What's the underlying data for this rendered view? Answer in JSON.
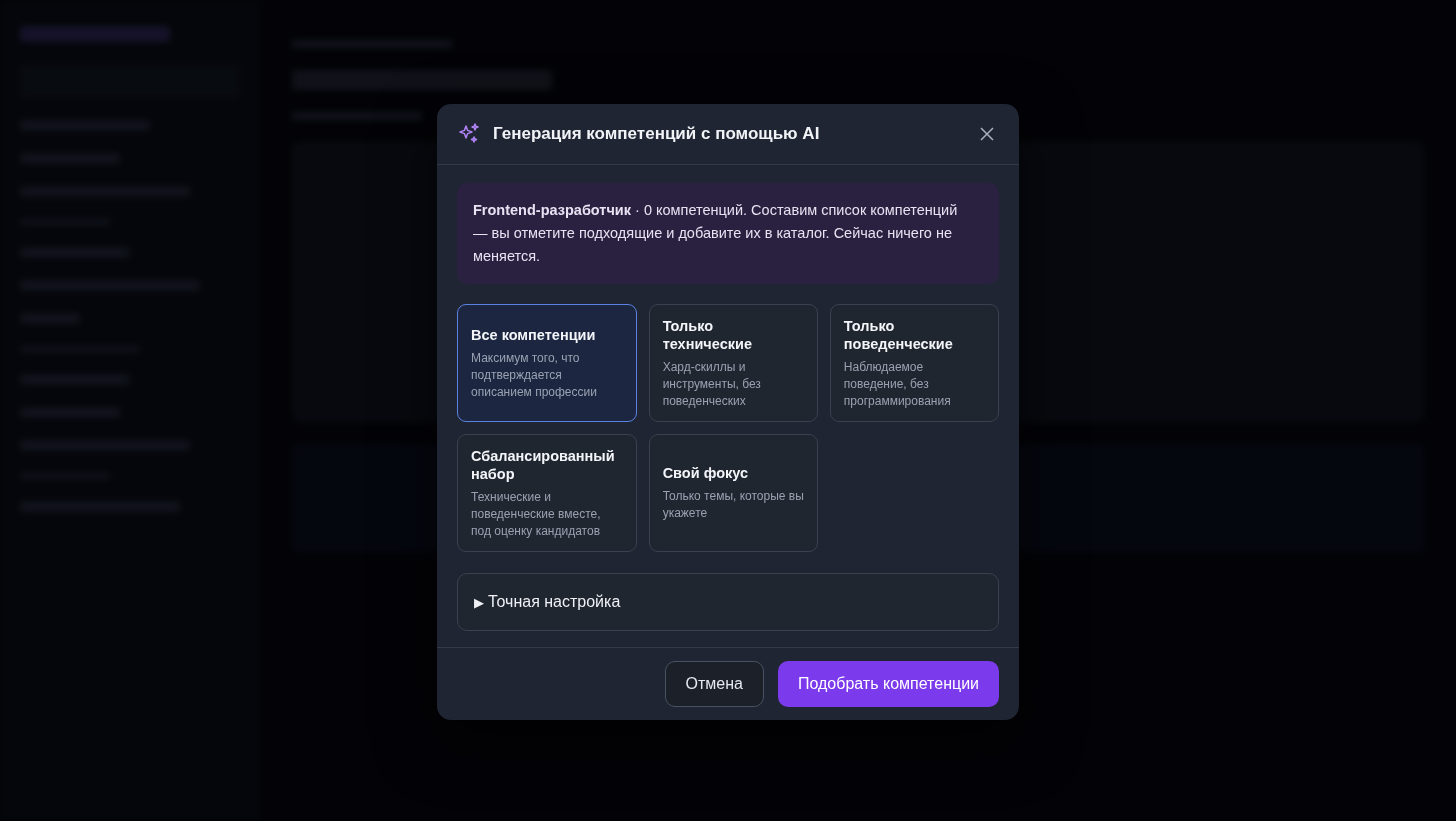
{
  "dialog": {
    "title": "Генерация компетенций с помощью AI",
    "intro": "**Frontend-разработчик** · 0 компетенций. Составим список компетенций — вы отметите подходящие и добавите их в каталог. Сейчас ничего не меняется.",
    "options": [
      {
        "title": "Все компетенции",
        "description": "Максимум того, что подтверждается описанием профессии",
        "selected": true
      },
      {
        "title": "Только технические",
        "description": "Хард-скиллы и инструменты, без поведенческих",
        "selected": false
      },
      {
        "title": "Только поведенческие",
        "description": "Наблюдаемое поведение, без программирования",
        "selected": false
      },
      {
        "title": "Сбалансированный набор",
        "description": "Технические и поведенческие вместе, под оценку кандидатов",
        "selected": false
      },
      {
        "title": "Свой фокус",
        "description": "Только темы, которые вы укажете",
        "selected": false
      }
    ],
    "advanced": {
      "marker": "▶",
      "label": "Точная настройка",
      "expanded": false
    },
    "buttons": [
      {
        "label": "Отмена",
        "kind": "secondary"
      },
      {
        "label": "Подобрать компетенции",
        "kind": "primary"
      }
    ]
  }
}
